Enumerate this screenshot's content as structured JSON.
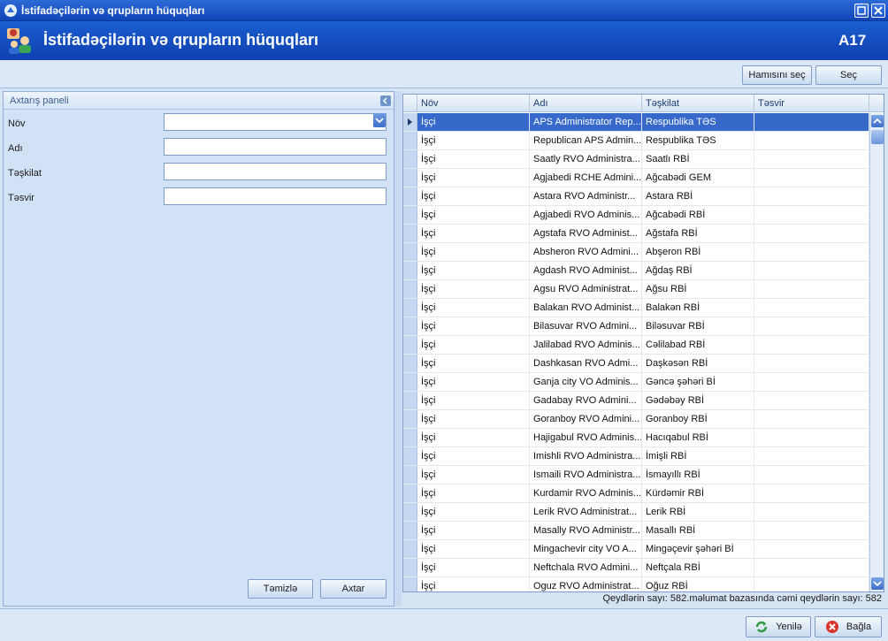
{
  "window": {
    "title": "İstifadəçilərin və qrupların hüquqları"
  },
  "header": {
    "title": "İstifadəçilərin və qrupların hüquqları",
    "code": "A17"
  },
  "toolbar": {
    "select_all": "Hamısını seç",
    "select": "Seç"
  },
  "search_panel": {
    "title": "Axtarış paneli",
    "fields": [
      {
        "label": "Növ",
        "value": ""
      },
      {
        "label": "Adı",
        "value": ""
      },
      {
        "label": "Təşkilat",
        "value": ""
      },
      {
        "label": "Təsvir",
        "value": ""
      }
    ],
    "clear_button": "Təmizlə",
    "search_button": "Axtar"
  },
  "grid": {
    "columns": [
      "Növ",
      "Adı",
      "Təşkilat",
      "Təsvir"
    ],
    "rows": [
      [
        "İşçi",
        "APS Administrator Rep...",
        "Respublika TƏS",
        ""
      ],
      [
        "İşçi",
        "Republican APS Admin...",
        "Respublika TƏS",
        ""
      ],
      [
        "İşçi",
        "Saatly RVO Administra...",
        "Saatlı RBİ",
        ""
      ],
      [
        "İşçi",
        "Agjabedi RCHE Admini...",
        "Ağcabədi GEM",
        ""
      ],
      [
        "İşçi",
        "Astara RVO Administr...",
        "Astara RBİ",
        ""
      ],
      [
        "İşçi",
        "Agjabedi RVO Adminis...",
        "Ağcabədi RBİ",
        ""
      ],
      [
        "İşçi",
        "Agstafa RVO Administ...",
        "Ağstafa RBİ",
        ""
      ],
      [
        "İşçi",
        "Absheron RVO Admini...",
        "Abşeron RBİ",
        ""
      ],
      [
        "İşçi",
        "Agdash RVO Administ...",
        "Ağdaş RBİ",
        ""
      ],
      [
        "İşçi",
        "Agsu RVO Administrat...",
        "Ağsu RBİ",
        ""
      ],
      [
        "İşçi",
        "Balakan RVO Administ...",
        "Balakən RBİ",
        ""
      ],
      [
        "İşçi",
        "Bilasuvar RVO Admini...",
        "Biləsuvar RBİ",
        ""
      ],
      [
        "İşçi",
        "Jalilabad RVO Adminis...",
        "Cəlilabad RBİ",
        ""
      ],
      [
        "İşçi",
        "Dashkasan RVO Admi...",
        "Daşkəsən RBİ",
        ""
      ],
      [
        "İşçi",
        "Ganja city VO Adminis...",
        "Gəncə şəhəri Bİ",
        ""
      ],
      [
        "İşçi",
        "Gadabay RVO Admini...",
        "Gədəbəy RBİ",
        ""
      ],
      [
        "İşçi",
        "Goranboy RVO Admini...",
        "Goranboy RBİ",
        ""
      ],
      [
        "İşçi",
        "Hajigabul RVO Adminis...",
        "Hacıqabul RBİ",
        ""
      ],
      [
        "İşçi",
        "Imishli RVO Administra...",
        "İmişli RBİ",
        ""
      ],
      [
        "İşçi",
        "Ismaili RVO Administra...",
        "İsmayıllı RBİ",
        ""
      ],
      [
        "İşçi",
        "Kurdamir RVO Adminis...",
        "Kürdəmir RBİ",
        ""
      ],
      [
        "İşçi",
        "Lerik RVO Administrat...",
        "Lerik RBİ",
        ""
      ],
      [
        "İşçi",
        "Masally RVO Administr...",
        "Masallı RBİ",
        ""
      ],
      [
        "İşçi",
        "Mingachevir city VO A...",
        "Mingəçevir şəhəri Bİ",
        ""
      ],
      [
        "İşçi",
        "Neftchala RVO Admini...",
        "Neftçala RBİ",
        ""
      ],
      [
        "İşçi",
        "Oguz RVO Administrat...",
        "Oğuz RBİ",
        ""
      ]
    ],
    "selected_row": 0,
    "status": "Qeydlərin sayı: 582.məlumat bazasında cəmi qeydlərin sayı: 582"
  },
  "bottom": {
    "refresh": "Yenilə",
    "close": "Bağla"
  },
  "colors": {
    "selected": "#3669c9",
    "header_band": "#1b5fcf"
  }
}
